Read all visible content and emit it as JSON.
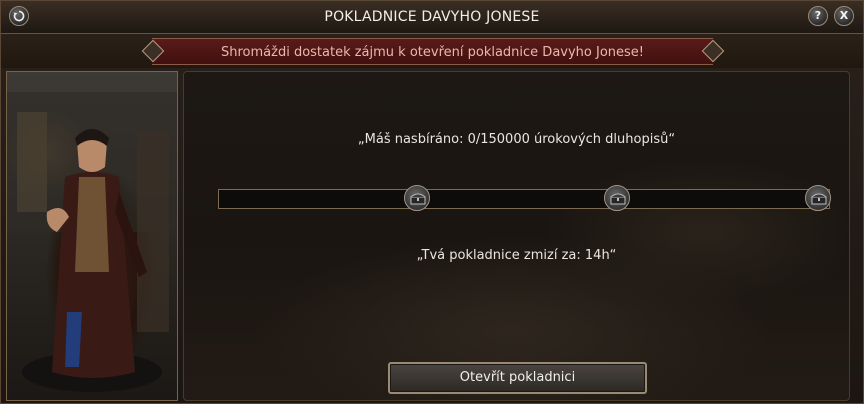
{
  "window": {
    "title": "POKLADNICE DAVYHO JONESE",
    "back_icon": "refresh-icon",
    "help_label": "?",
    "close_label": "X"
  },
  "banner": {
    "text": "Shromáždi dostatek zájmu k otevření pokladnice Davyho Jonese!"
  },
  "status": {
    "collected_text": "„Máš nasbíráno: 0/150000 úrokových dluhopisů“",
    "progress_fraction": 0,
    "milestones": [
      "chest-icon",
      "chest-icon",
      "chest-icon"
    ],
    "countdown_text": "„Tvá pokladnice zmizí za: 14h“"
  },
  "actions": {
    "open_label": "Otevřít pokladnici"
  },
  "colors": {
    "banner": "#5b1a1a",
    "title_text": "#f3eee6",
    "banner_text": "#e9b8a8"
  }
}
